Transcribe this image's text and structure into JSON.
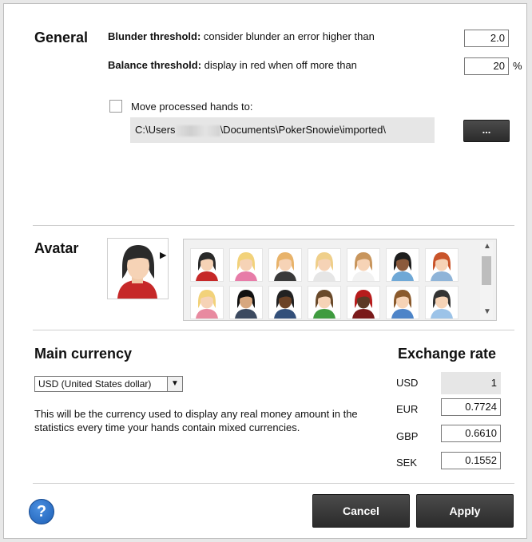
{
  "general": {
    "title": "General",
    "blunder_label_bold": "Blunder threshold:",
    "blunder_label_rest": " consider blunder an error higher than",
    "blunder_value": "2.0",
    "balance_label_bold": "Balance threshold:",
    "balance_label_rest": " display in red when off more than",
    "balance_value": "20",
    "balance_unit": "%",
    "move_label": "Move processed hands to:",
    "move_checked": false,
    "path_prefix": "C:\\Users",
    "path_suffix": "\\Documents\\PokerSnowie\\imported\\",
    "browse_label": "..."
  },
  "avatar": {
    "title": "Avatar",
    "selected_icon": "female-avatar-dark-hair-icon",
    "gallery_icons": [
      "avatar-female-dark-hair-icon",
      "avatar-female-pink-sunglasses-icon",
      "avatar-female-blonde-icon",
      "avatar-female-blonde-pigtails-icon",
      "avatar-female-light-brown-icon",
      "avatar-female-dark-skin-icon",
      "avatar-male-redhead-icon",
      "avatar-female-blonde-red-top-icon",
      "avatar-female-black-hair-icon",
      "avatar-male-dark-skin-icon",
      "avatar-male-green-shirt-icon",
      "avatar-male-red-cap-icon",
      "avatar-male-blue-shirt-icon",
      "avatar-male-light-blue-shirt-icon"
    ]
  },
  "currency": {
    "title": "Main currency",
    "selected": "USD (United States dollar)",
    "description": "This will be the currency used to display any real money amount in the statistics every time your hands contain mixed currencies."
  },
  "exchange": {
    "title": "Exchange rate",
    "rates": [
      {
        "code": "USD",
        "value": "1"
      },
      {
        "code": "EUR",
        "value": "0.7724"
      },
      {
        "code": "GBP",
        "value": "0.6610"
      },
      {
        "code": "SEK",
        "value": "0.1552"
      }
    ]
  },
  "footer": {
    "help_label": "?",
    "cancel_label": "Cancel",
    "apply_label": "Apply"
  },
  "colors": {
    "button_dark": "#333333",
    "help_blue": "#1d5fb6",
    "disabled_field": "#e6e6e6"
  }
}
